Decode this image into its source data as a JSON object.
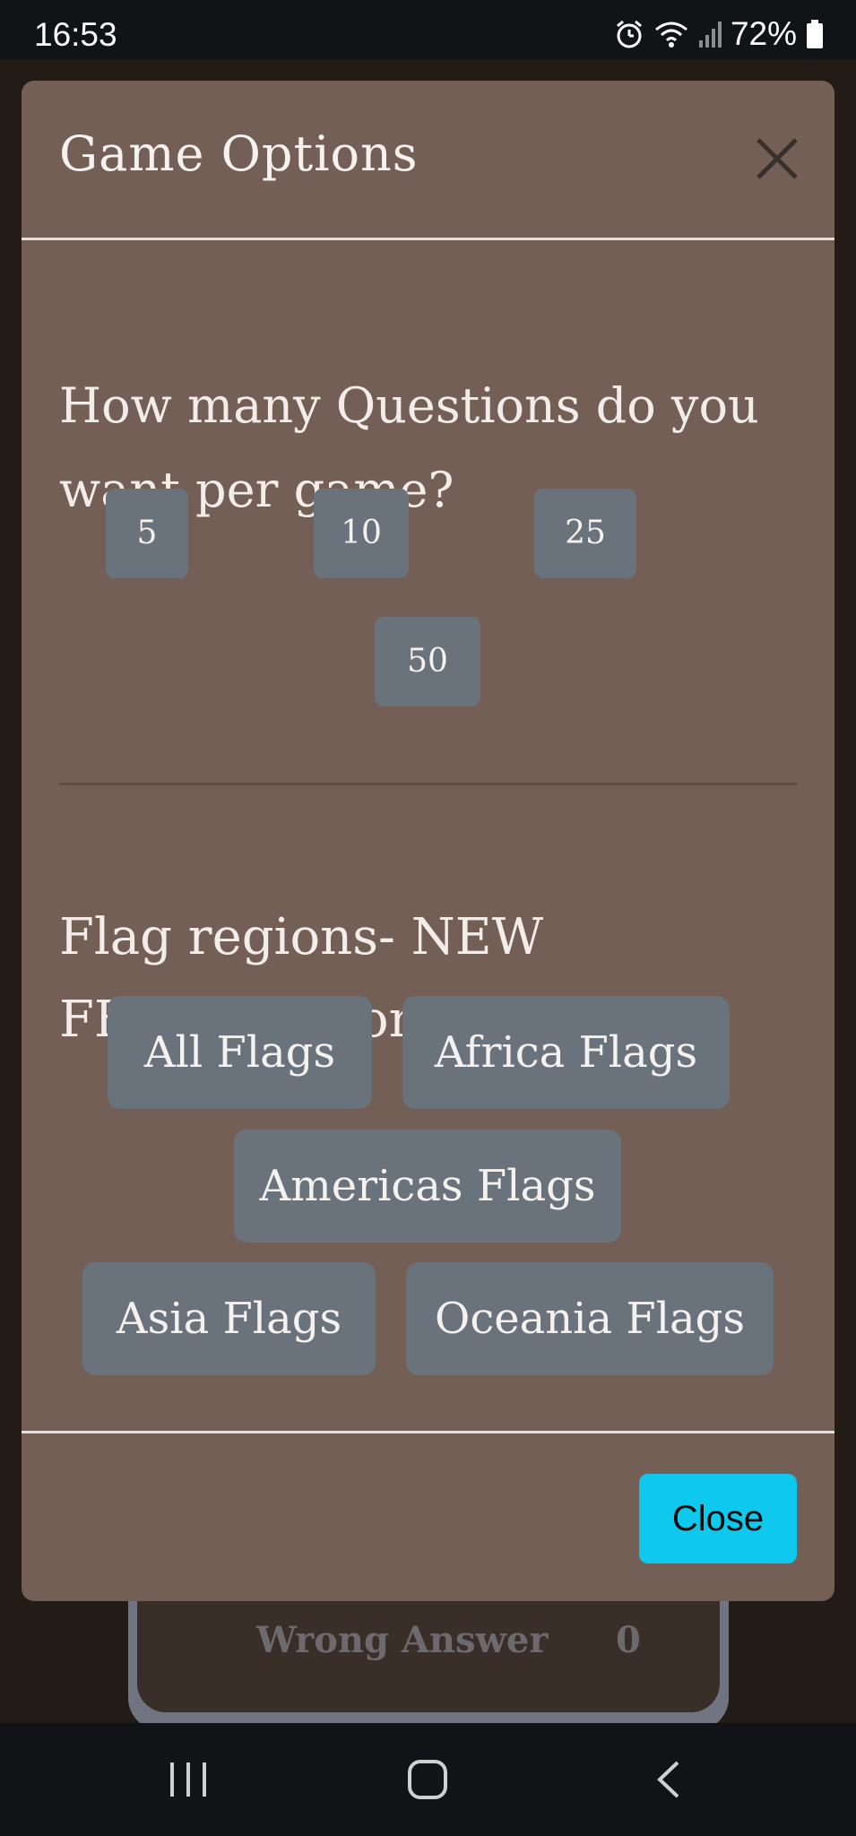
{
  "status_bar": {
    "time": "16:53",
    "battery": "72%",
    "icons": [
      "alarm-icon",
      "wifi-icon",
      "signal-icon",
      "battery-icon"
    ]
  },
  "background": {
    "wrong_answer_label": "Wrong Answer",
    "wrong_answer_value": "0"
  },
  "modal": {
    "title": "Game Options",
    "questions_heading": "How many Questions do you want per game?",
    "question_counts": [
      "5",
      "10",
      "25",
      "50"
    ],
    "regions_heading": "Flag regions- NEW FEATURE coming soon!",
    "regions": [
      "All Flags",
      "Africa Flags",
      "Americas Flags",
      "Asia Flags",
      "Oceania Flags"
    ],
    "close_label": "Close"
  },
  "nav_bar": {
    "icons": [
      "recent-apps-icon",
      "home-icon",
      "back-icon"
    ]
  },
  "colors": {
    "modal_bg": "#735f55",
    "button_bg": "#6a727c",
    "close_button_bg": "#0ec8ee",
    "system_bar": "#121317"
  }
}
